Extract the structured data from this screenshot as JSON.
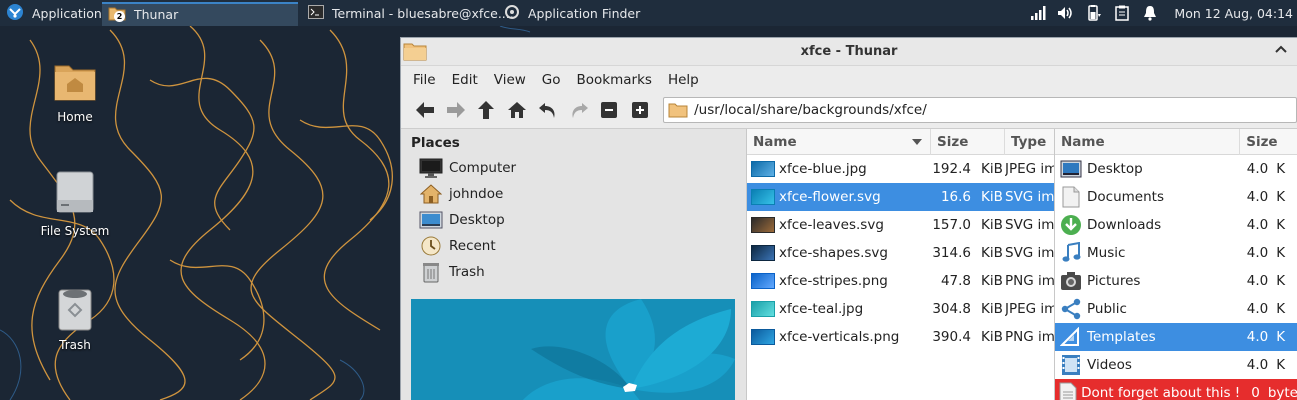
{
  "panel": {
    "applications_label": "Applications",
    "tasks": [
      {
        "label": "Thunar",
        "badge": "2"
      },
      {
        "label": "Terminal - bluesabre@xfce...."
      },
      {
        "label": "Application Finder"
      }
    ],
    "clock": "Mon 12 Aug, 04:14"
  },
  "desktop": {
    "icons": [
      {
        "label": "Home"
      },
      {
        "label": "File System"
      },
      {
        "label": "Trash"
      }
    ]
  },
  "window": {
    "title": "xfce - Thunar",
    "menu": [
      "File",
      "Edit",
      "View",
      "Go",
      "Bookmarks",
      "Help"
    ],
    "path": "/usr/local/share/backgrounds/xfce/",
    "places_header": "Places",
    "places": [
      {
        "label": "Computer",
        "icon": "computer-icon"
      },
      {
        "label": "johndoe",
        "icon": "home-icon"
      },
      {
        "label": "Desktop",
        "icon": "desktop-icon"
      },
      {
        "label": "Recent",
        "icon": "recent-icon"
      },
      {
        "label": "Trash",
        "icon": "trash-icon"
      }
    ],
    "pane1": {
      "columns": [
        "Name",
        "Size",
        "Type"
      ],
      "rows": [
        {
          "name": "xfce-blue.jpg",
          "size": "192.4",
          "unit": "KiB",
          "type": "JPEG im",
          "selected": false
        },
        {
          "name": "xfce-flower.svg",
          "size": "16.6",
          "unit": "KiB",
          "type": "SVG im",
          "selected": true
        },
        {
          "name": "xfce-leaves.svg",
          "size": "157.0",
          "unit": "KiB",
          "type": "SVG im",
          "selected": false
        },
        {
          "name": "xfce-shapes.svg",
          "size": "314.6",
          "unit": "KiB",
          "type": "SVG im",
          "selected": false
        },
        {
          "name": "xfce-stripes.png",
          "size": "47.8",
          "unit": "KiB",
          "type": "PNG im",
          "selected": false
        },
        {
          "name": "xfce-teal.jpg",
          "size": "304.8",
          "unit": "KiB",
          "type": "JPEG im",
          "selected": false
        },
        {
          "name": "xfce-verticals.png",
          "size": "390.4",
          "unit": "KiB",
          "type": "PNG im",
          "selected": false
        }
      ]
    },
    "pane2": {
      "columns": [
        "Name",
        "Size"
      ],
      "rows": [
        {
          "name": "Desktop",
          "size": "4.0",
          "unit": "K",
          "icon": "desktop-folder-icon"
        },
        {
          "name": "Documents",
          "size": "4.0",
          "unit": "K",
          "icon": "documents-folder-icon"
        },
        {
          "name": "Downloads",
          "size": "4.0",
          "unit": "K",
          "icon": "downloads-folder-icon"
        },
        {
          "name": "Music",
          "size": "4.0",
          "unit": "K",
          "icon": "music-folder-icon"
        },
        {
          "name": "Pictures",
          "size": "4.0",
          "unit": "K",
          "icon": "pictures-folder-icon"
        },
        {
          "name": "Public",
          "size": "4.0",
          "unit": "K",
          "icon": "public-folder-icon"
        },
        {
          "name": "Templates",
          "size": "4.0",
          "unit": "K",
          "icon": "templates-folder-icon"
        },
        {
          "name": "Videos",
          "size": "4.0",
          "unit": "K",
          "icon": "videos-folder-icon"
        },
        {
          "name": "Dont forget about this !",
          "size": "0",
          "unit": "byte",
          "icon": "text-file-icon"
        }
      ]
    }
  },
  "colors": {
    "selection": "#3d8ee1",
    "highlight_red": "#e62d2d",
    "panel_bg": "#1f2d3d",
    "wallpaper_line": "#e8a33c"
  }
}
